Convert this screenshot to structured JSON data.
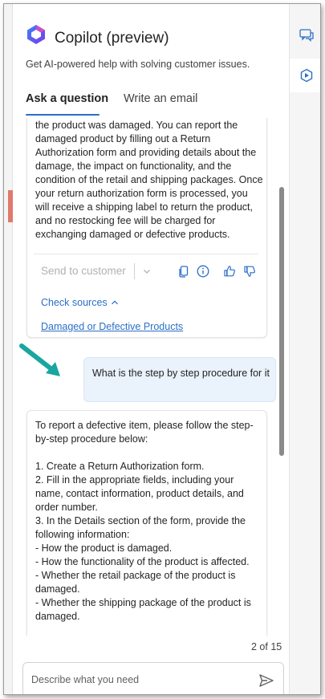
{
  "header": {
    "title": "Copilot (preview)",
    "subtitle": "Get AI-powered help with solving customer issues."
  },
  "tabs": [
    {
      "label": "Ask a question",
      "active": true
    },
    {
      "label": "Write an email",
      "active": false
    }
  ],
  "messages": {
    "response1": {
      "text": "the product was damaged. You can report the damaged product by filling out a Return Authorization form and providing details about the damage, the impact on functionality, and the condition of the retail and shipping packages. Once your return authorization form is processed, you will receive a shipping label to return the product, and no restocking fee will be charged for exchanging damaged or defective products.",
      "send_label": "Send to customer",
      "check_sources_label": "Check sources",
      "source_link": "Damaged or Defective Products"
    },
    "user_question": "What is the step by step procedure for it",
    "response2": {
      "intro": "To report a defective item, please follow the step-by-step procedure below:",
      "lines": [
        "1. Create a Return Authorization form.",
        "2. Fill in the appropriate fields, including your name, contact information, product details, and order number.",
        "3. In the Details section of the form, provide the following information:",
        "- How the product is damaged.",
        "- How the functionality of the product is affected.",
        "- Whether the retail package of the product is damaged.",
        "- Whether the shipping package of the product is damaged."
      ]
    }
  },
  "pagination": "2 of 15",
  "input": {
    "placeholder": "Describe what you need",
    "value": ""
  },
  "colors": {
    "accent": "#2b6fc7",
    "arrow": "#1aa6a0",
    "user_bubble": "#eaf2fc"
  }
}
